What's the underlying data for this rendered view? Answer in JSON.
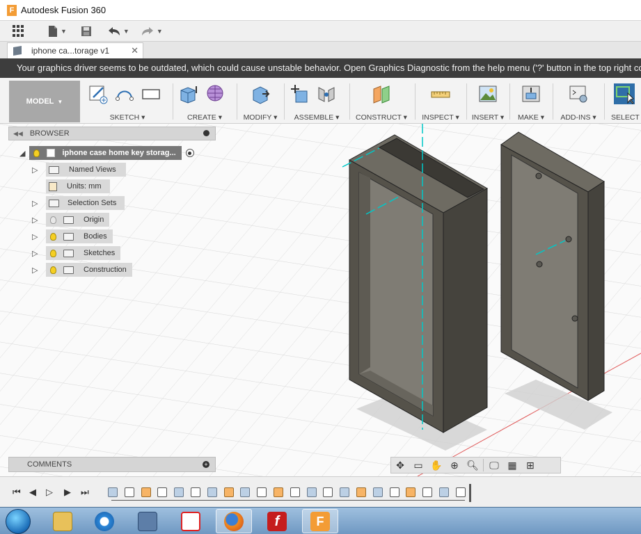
{
  "window": {
    "title": "Autodesk Fusion 360",
    "logo_letter": "F"
  },
  "qat": {
    "apps_icon": "apps-grid-icon",
    "file_icon": "file-icon",
    "save_icon": "save-icon",
    "undo_icon": "undo-icon",
    "redo_icon": "redo-icon"
  },
  "doc_tab": {
    "label": "iphone ca...torage v1",
    "close": "✕"
  },
  "banner": {
    "text": "Your graphics driver seems to be outdated, which could cause unstable behavior. Open Graphics Diagnostic from the help menu ('?' button in the top right co"
  },
  "ribbon": {
    "workspace": "MODEL",
    "groups": [
      {
        "label": "SKETCH",
        "icons": [
          "sketch-icon",
          "arc-icon",
          "rectangle-icon"
        ]
      },
      {
        "label": "CREATE",
        "icons": [
          "box-icon",
          "form-icon"
        ]
      },
      {
        "label": "MODIFY",
        "icons": [
          "press-pull-icon"
        ]
      },
      {
        "label": "ASSEMBLE",
        "icons": [
          "new-component-icon",
          "joint-icon"
        ]
      },
      {
        "label": "CONSTRUCT",
        "icons": [
          "plane-icon"
        ]
      },
      {
        "label": "INSPECT",
        "icons": [
          "measure-icon"
        ]
      },
      {
        "label": "INSERT",
        "icons": [
          "image-icon"
        ]
      },
      {
        "label": "MAKE",
        "icons": [
          "3d-print-icon"
        ]
      },
      {
        "label": "ADD-INS",
        "icons": [
          "scripts-icon"
        ]
      },
      {
        "label": "SELECT",
        "icons": [
          "select-icon"
        ]
      }
    ]
  },
  "browser": {
    "title": "BROWSER",
    "root": "iphone case home key storag...",
    "items": [
      {
        "label": "Named Views",
        "bulb": "none",
        "expandable": true
      },
      {
        "label": "Units: mm",
        "bulb": "none",
        "expandable": false
      },
      {
        "label": "Selection Sets",
        "bulb": "none",
        "expandable": true
      },
      {
        "label": "Origin",
        "bulb": "off",
        "expandable": true
      },
      {
        "label": "Bodies",
        "bulb": "on",
        "expandable": true
      },
      {
        "label": "Sketches",
        "bulb": "on",
        "expandable": true
      },
      {
        "label": "Construction",
        "bulb": "on",
        "expandable": true
      }
    ]
  },
  "comments": {
    "title": "COMMENTS"
  },
  "colors": {
    "model_body": "#55524a",
    "model_top": "#6e6b62",
    "model_inner": "#7f7c74",
    "warning_bg": "#3d3d3d",
    "axis_cyan": "#00c8c8"
  },
  "navbar": {
    "icons": [
      "orbit-icon",
      "look-at-icon",
      "pan-icon",
      "zoom-icon",
      "fit-icon",
      "display-settings-icon",
      "grid-settings-icon",
      "viewports-icon"
    ]
  },
  "timeline": {
    "controls": [
      "first-icon",
      "previous-icon",
      "play-icon",
      "next-icon",
      "last-icon"
    ],
    "feature_count": 22
  },
  "taskbar": {
    "apps": [
      "windows-start-icon",
      "file-explorer-icon",
      "internet-explorer-icon",
      "app-star-icon",
      "app-red-icon",
      "firefox-icon",
      "flash-icon",
      "fusion-360-icon"
    ]
  }
}
